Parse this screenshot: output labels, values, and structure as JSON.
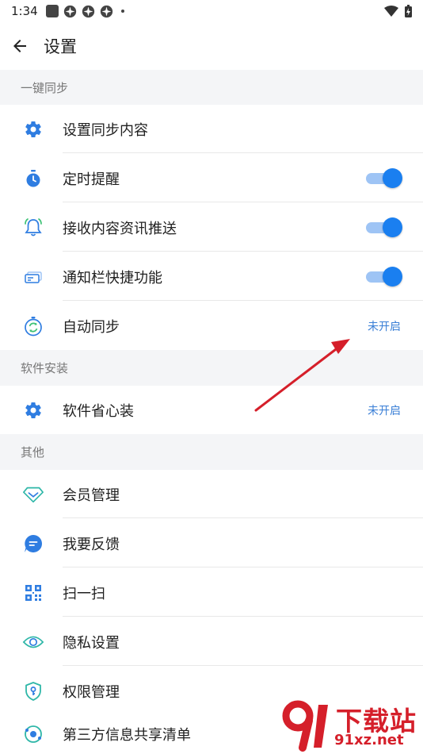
{
  "status_bar": {
    "time": "1:34"
  },
  "header": {
    "title": "设置"
  },
  "sections": [
    {
      "title": "一键同步"
    },
    {
      "title": "软件安装"
    },
    {
      "title": "其他"
    }
  ],
  "items": [
    {
      "label": "设置同步内容",
      "icon": "gear-icon"
    },
    {
      "label": "定时提醒",
      "icon": "stopwatch-icon",
      "toggle": true
    },
    {
      "label": "接收内容资讯推送",
      "icon": "bell-icon",
      "toggle": true
    },
    {
      "label": "通知栏快捷功能",
      "icon": "notification-card-icon",
      "toggle": true
    },
    {
      "label": "自动同步",
      "icon": "sync-icon",
      "value": "未开启"
    },
    {
      "label": "软件省心装",
      "icon": "gear-icon",
      "value": "未开启"
    },
    {
      "label": "会员管理",
      "icon": "diamond-icon"
    },
    {
      "label": "我要反馈",
      "icon": "chat-bubble-icon"
    },
    {
      "label": "扫一扫",
      "icon": "qr-code-icon"
    },
    {
      "label": "隐私设置",
      "icon": "eye-icon"
    },
    {
      "label": "权限管理",
      "icon": "shield-key-icon"
    },
    {
      "label": "第三方信息共享清单",
      "icon": "share-list-icon"
    }
  ],
  "watermark": {
    "top": "下载站",
    "bottom": "91xz.net"
  },
  "colors": {
    "accent": "#1a7ff0",
    "value_text": "#3a7fd6",
    "section_bg": "#f4f5f7",
    "arrow": "#d51f2a"
  }
}
